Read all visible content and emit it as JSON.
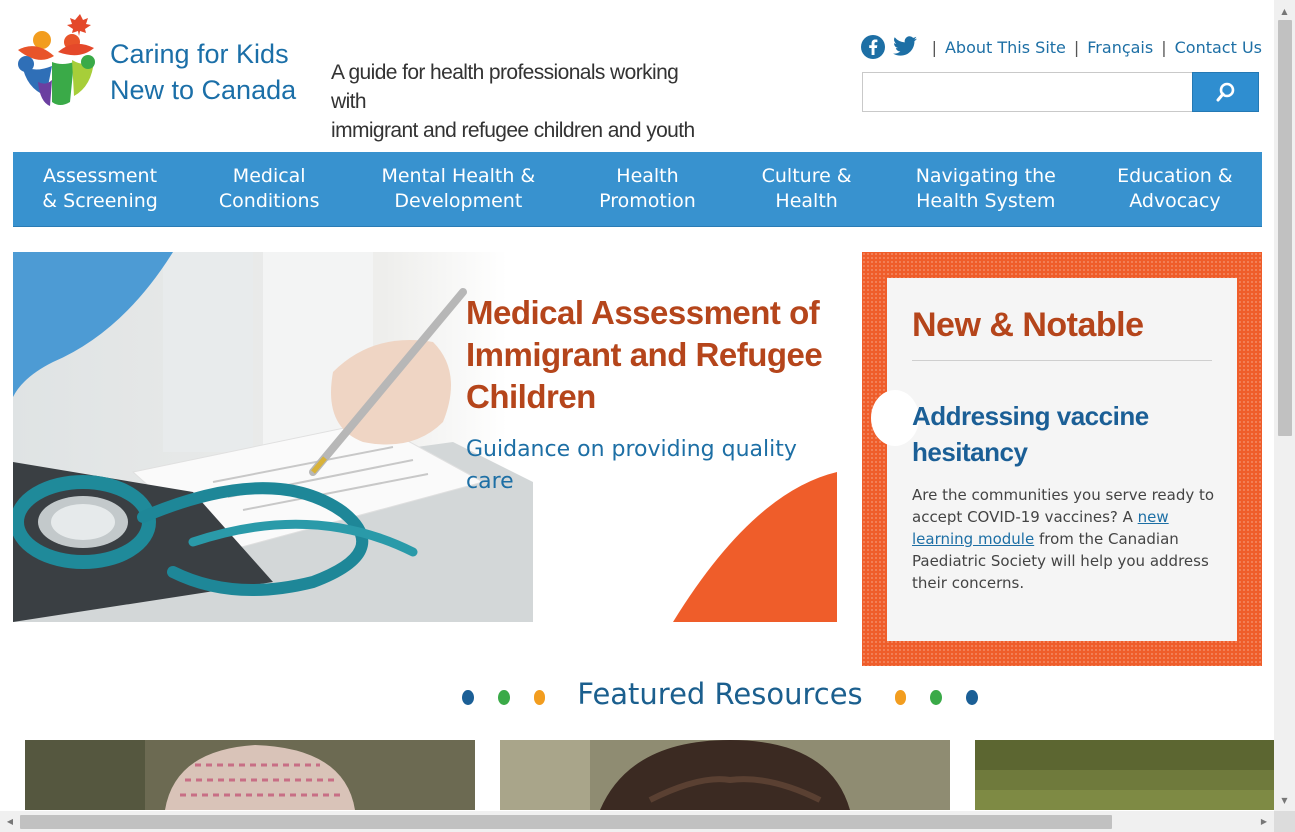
{
  "site": {
    "logo_line1": "Caring for Kids",
    "logo_line2": "New to Canada",
    "tagline_line1": "A guide for health professionals working",
    "tagline_line2": "with",
    "tagline_line3": "immigrant and refugee children and youth"
  },
  "utility": {
    "facebook_icon": "facebook-icon",
    "twitter_icon": "twitter-icon",
    "links": [
      {
        "label": "About This Site"
      },
      {
        "label": "Français"
      },
      {
        "label": "Contact Us"
      }
    ],
    "separator": "|"
  },
  "search": {
    "value": "",
    "placeholder": "",
    "button_icon": "search-icon"
  },
  "nav": {
    "items": [
      {
        "label": "Assessment & Screening"
      },
      {
        "label": "Medical Conditions"
      },
      {
        "label": "Mental Health & Development"
      },
      {
        "label": "Health Promotion"
      },
      {
        "label": "Culture & Health"
      },
      {
        "label": "Navigating the Health System"
      },
      {
        "label": "Education & Advocacy"
      }
    ]
  },
  "hero": {
    "title": "Medical Assessment of Immigrant and Refugee Children",
    "subtitle": "Guidance on providing quality care"
  },
  "notable": {
    "heading": "New & Notable",
    "headline": "Addressing vaccine hesitancy",
    "body_before": "Are the communities you serve ready to accept COVID-19 vaccines? A ",
    "link_text": "new learning module",
    "body_after": " from the Canadian Paediatric Society will help you address their concerns."
  },
  "featured": {
    "heading": "Featured Resources",
    "dot_colors": [
      "#1b5f96",
      "#3aaa48",
      "#f29d1f",
      "#f29d1f",
      "#3aaa48",
      "#1b5f96"
    ]
  },
  "colors": {
    "nav_blue": "#3892cf",
    "accent_orange": "#ef5d2a",
    "title_rust": "#b5451b",
    "link_blue": "#1d6fa5"
  }
}
